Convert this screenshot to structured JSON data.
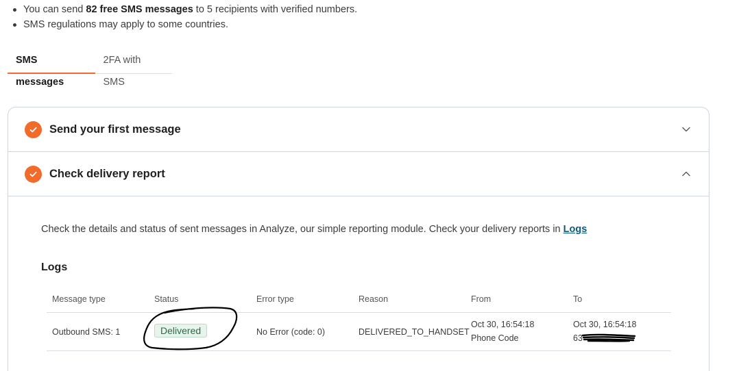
{
  "bullets": [
    {
      "pre": "You can send ",
      "bold": "82 free SMS messages",
      "post": " to 5 recipients with verified numbers."
    },
    {
      "pre": "SMS regulations may apply to some countries.",
      "bold": "",
      "post": ""
    }
  ],
  "tabs": [
    {
      "label": "SMS messages",
      "active": true
    },
    {
      "label": "2FA with SMS",
      "active": false
    }
  ],
  "accordion": [
    {
      "title": "Send your first message",
      "expanded": false
    },
    {
      "title": "Check delivery report",
      "expanded": true
    }
  ],
  "delivery": {
    "intro": "Check the details and status of sent messages in Analyze, our simple reporting module. Check your delivery reports in ",
    "link": "Logs",
    "logs_title": "Logs"
  },
  "table": {
    "headers": [
      "Message type",
      "Status",
      "Error type",
      "Reason",
      "From",
      "To"
    ],
    "row": {
      "message_type": "Outbound SMS: 1",
      "status": "Delivered",
      "error_type": "No Error (code: 0)",
      "reason": "DELIVERED_TO_HANDSET",
      "from_time": "Oct 30, 16:54:18",
      "from_sub": "Phone Code",
      "to_time": "Oct 30, 16:54:18",
      "to_sub": "63"
    }
  },
  "colors": {
    "accent": "#f26b2a",
    "link": "#0d5b7c",
    "status_bg": "#e6f4ec",
    "status_text": "#2d6a45"
  },
  "icons": [
    "check-circle-icon",
    "chevron-down-icon",
    "chevron-up-icon"
  ]
}
